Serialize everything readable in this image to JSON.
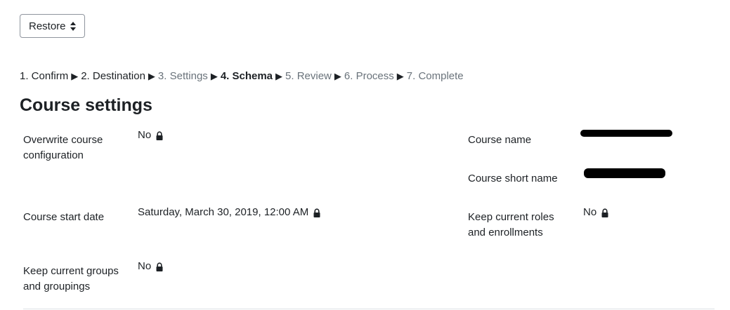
{
  "restore_menu": {
    "label": "Restore"
  },
  "progress": {
    "steps": [
      {
        "label": "1. Confirm",
        "state": "done"
      },
      {
        "label": "2. Destination",
        "state": "done"
      },
      {
        "label": "3. Settings",
        "state": "todo"
      },
      {
        "label": "4. Schema",
        "state": "current"
      },
      {
        "label": "5. Review",
        "state": "todo"
      },
      {
        "label": "6. Process",
        "state": "todo"
      },
      {
        "label": "7. Complete",
        "state": "todo"
      }
    ],
    "separator": "▶"
  },
  "section": {
    "title": "Course settings"
  },
  "settings": {
    "overwrite": {
      "label": "Overwrite course configuration",
      "value": "No"
    },
    "start_date": {
      "label": "Course start date",
      "value": "Saturday, March 30, 2019, 12:00 AM"
    },
    "keep_groups": {
      "label": "Keep current groups and groupings",
      "value": "No"
    },
    "course_name": {
      "label": "Course name"
    },
    "short_name": {
      "label": "Course short name"
    },
    "keep_roles": {
      "label": "Keep current roles and enrollments",
      "value": "No"
    }
  },
  "icons": {
    "lock": "lock-icon",
    "caret": "sort-caret-icon"
  },
  "colors": {
    "text": "#1d2125",
    "muted": "#6a737b",
    "border": "#8f959e"
  }
}
